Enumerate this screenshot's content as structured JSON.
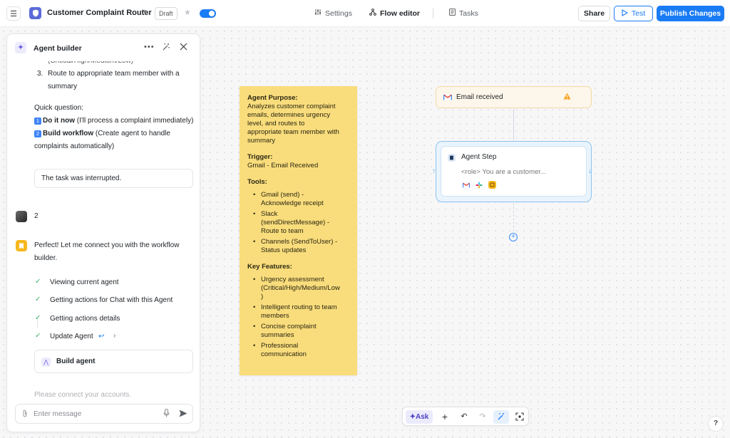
{
  "header": {
    "app_title": "Customer Complaint Router",
    "draft_label": "Draft",
    "nav": {
      "settings": "Settings",
      "flow_editor": "Flow editor",
      "tasks": "Tasks"
    },
    "share_label": "Share",
    "test_label": "Test",
    "publish_label": "Publish Changes",
    "toggle_on": true
  },
  "agent_builder": {
    "title": "Agent builder",
    "messages": {
      "cut_line": "(Critical/High/Medium/Low)",
      "list_num": "3.",
      "list_item_line1": "Route to appropriate team member with a",
      "list_item_line2": "summary",
      "quick_question": "Quick question:",
      "option1_badge": "1",
      "option1_bold": "Do it now",
      "option1_rest": " (I'll process a complaint immediately)",
      "option2_badge": "2",
      "option2_bold": "Build workflow",
      "option2_rest": " (Create agent to handle",
      "option2_line2": "complaints automatically)",
      "interrupted": "The task was interrupted.",
      "user_reply": "2",
      "agent_reply_line1": "Perfect! Let me connect you with the workflow",
      "agent_reply_line2": "builder."
    },
    "steps": [
      {
        "label": "Viewing current agent"
      },
      {
        "label": "Getting actions for Chat with this Agent"
      },
      {
        "label": "Getting actions details"
      },
      {
        "label": "Update Agent"
      }
    ],
    "build_card_label": "Build agent",
    "faded_text": "Please connect your accounts.",
    "input_placeholder": "Enter message"
  },
  "sticky_note": {
    "purpose_heading": "Agent Purpose:",
    "purpose_lines": [
      "Analyzes customer complaint",
      "emails, determines urgency",
      "level, and routes to",
      "appropriate team member with",
      "summary"
    ],
    "trigger_heading": "Trigger:",
    "trigger_text": "Gmail - Email Received",
    "tools_heading": "Tools:",
    "tools": [
      [
        "Gmail (send) -",
        "Acknowledge receipt"
      ],
      [
        "Slack",
        "(sendDirectMessage) -",
        "Route to team"
      ],
      [
        "Channels (SendToUser) -",
        "Status updates"
      ]
    ],
    "features_heading": "Key Features:",
    "features": [
      [
        "Urgency assessment",
        "(Critical/High/Medium/Low",
        ")"
      ],
      [
        "Intelligent routing to team",
        "members"
      ],
      [
        "Concise complaint",
        "summaries"
      ],
      [
        "Professional",
        "communication"
      ]
    ]
  },
  "flow": {
    "trigger_node": {
      "label": "Email received",
      "warning": true
    },
    "agent_node": {
      "title": "Agent Step",
      "prompt_preview": "<role> You are a customer..."
    }
  },
  "toolbar": {
    "ask_label": "Ask"
  },
  "help_label": "?",
  "colors": {
    "accent": "#1a7cf5",
    "sticky": "#f9dd7c",
    "success": "#3fae6a"
  }
}
